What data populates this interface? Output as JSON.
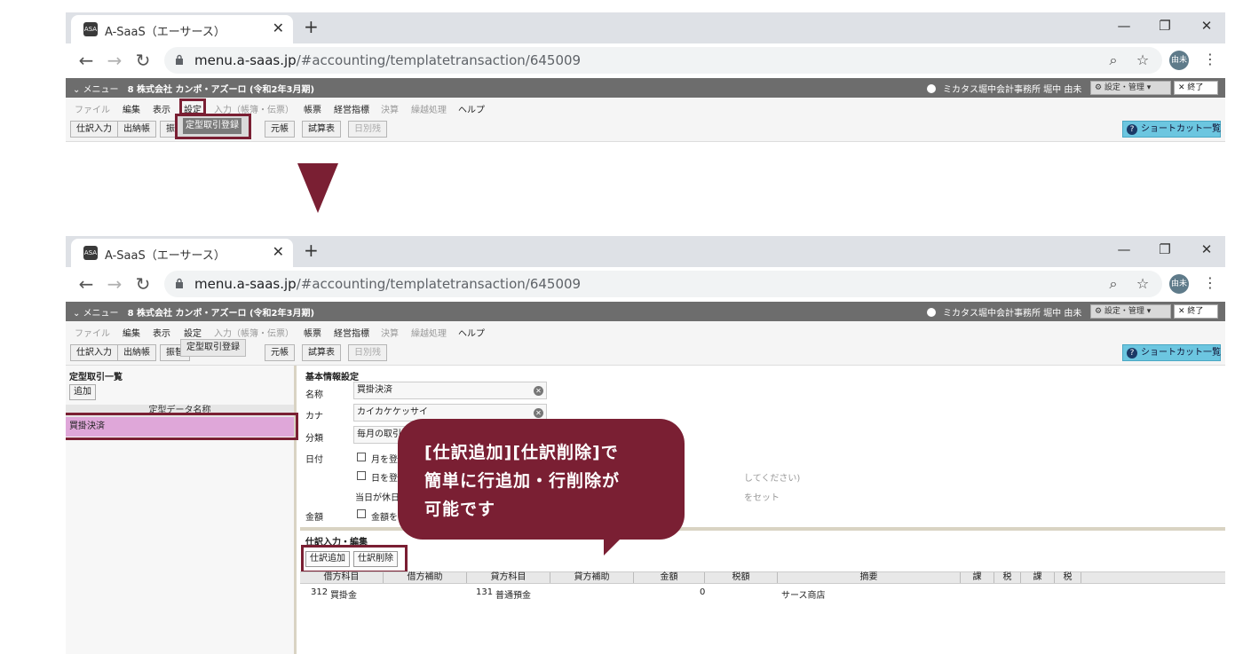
{
  "browser": {
    "tab_title": "A-SaaS（エーサース）",
    "tab_close": "✕",
    "new_tab": "+",
    "minimize": "—",
    "restore": "❐",
    "close": "✕",
    "url_host": "menu.a-saas.jp",
    "url_path": "/#accounting/templatetransaction/645009",
    "profile": "由未",
    "favicon_text": "ASA"
  },
  "appbar": {
    "menu": "⌄ メニュー",
    "company": "8 株式会社 カンポ・アズーロ (令和2年3月期)",
    "office": "ミカタス堀中会計事務所 堀中 由未",
    "settings": "⚙ 設定・管理 ▾",
    "logout": "✕ 終了"
  },
  "menubar": [
    {
      "label": "ファイル",
      "dim": true
    },
    {
      "label": "編集",
      "dim": false
    },
    {
      "label": "表示",
      "dim": false
    },
    {
      "label": "設定",
      "dim": false
    },
    {
      "label": "入力（帳簿・伝票）",
      "dim": true
    },
    {
      "label": "帳票",
      "dim": false
    },
    {
      "label": "経営指標",
      "dim": false
    },
    {
      "label": "決算",
      "dim": true
    },
    {
      "label": "繰越処理",
      "dim": true
    },
    {
      "label": "ヘルプ",
      "dim": false
    }
  ],
  "buttons": [
    {
      "label": "仕訳入力",
      "dim": false
    },
    {
      "label": "出納帳",
      "dim": false
    },
    {
      "label": "振替",
      "dim": false
    },
    {
      "label": "元帳",
      "dim": false
    },
    {
      "label": "試算表",
      "dim": false
    },
    {
      "label": "日別残",
      "dim": true
    }
  ],
  "shortcut": {
    "icon": "?",
    "label": "ショートカット一覧"
  },
  "dropdown_item": "定型取引登録",
  "left_pane": {
    "title": "定型取引一覧",
    "add": "追加",
    "header": "定型データ名称",
    "row": "買掛決済"
  },
  "basic": {
    "title": "基本情報設定",
    "name_label": "名称",
    "name_value": "買掛決済",
    "kana_label": "カナ",
    "kana_value": "カイカケケッサイ",
    "class_label": "分類",
    "class_value": "毎月の取引",
    "date_label": "日付",
    "date_opt1": "月を登",
    "date_opt2": "日を登",
    "date_hint": "してください)",
    "holiday": "当日が休日",
    "holiday_tail": "をセット",
    "amount_label": "金額",
    "amount_opt": "金額を",
    "clear": "✕"
  },
  "journal": {
    "title": "仕訳入力・編集",
    "add_btn": "仕訳追加",
    "del_btn": "仕訳削除",
    "headers": [
      "借方科目",
      "借方補助",
      "貸方科目",
      "貸方補助",
      "金額",
      "税額",
      "摘要",
      "課",
      "税",
      "課",
      "税"
    ],
    "row": {
      "debit_code": "312",
      "debit": "買掛金",
      "credit_code": "131",
      "credit": "普通預金",
      "amount": "0",
      "memo": "サース商店"
    }
  },
  "callout": {
    "line1": "[仕訳追加][仕訳削除]で",
    "line2": "簡単に行追加・行削除が",
    "line3": "可能です"
  },
  "colors": {
    "accent": "#7a1f33",
    "appbar": "#6d6d6d",
    "selected_row": "#dfa7d9",
    "shortcut": "#6cc6e0"
  }
}
